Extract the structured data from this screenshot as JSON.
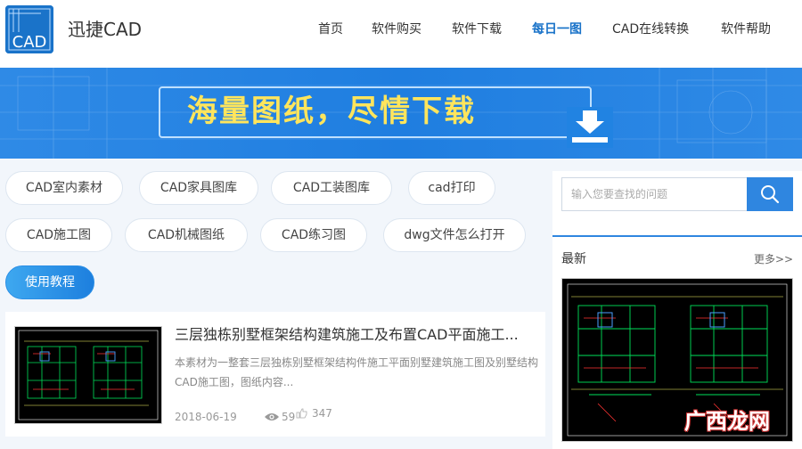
{
  "brand": {
    "logo_text": "CAD",
    "name": "迅捷CAD"
  },
  "nav": {
    "items": [
      {
        "label": "首页",
        "active": false
      },
      {
        "label": "软件购买",
        "active": false
      },
      {
        "label": "软件下载",
        "active": false
      },
      {
        "label": "每日一图",
        "active": true
      },
      {
        "label": "CAD在线转换",
        "active": false
      },
      {
        "label": "软件帮助",
        "active": false
      }
    ]
  },
  "banner": {
    "text": "海量图纸，尽情下载",
    "icon": "download-icon"
  },
  "tags": [
    "CAD室内素材",
    "CAD家具图库",
    "CAD工装图库",
    "cad打印",
    "CAD施工图",
    "CAD机械图纸",
    "CAD练习图",
    "dwg文件怎么打开",
    "使用教程"
  ],
  "article": {
    "title": "三层独栋别墅框架结构建筑施工及布置CAD平面施工...",
    "description": "本素材为一整套三层独栋别墅框架结构件施工平面别墅建筑施工图及别墅结构CAD施工图，图纸内容...",
    "date": "2018-06-19",
    "views": "59",
    "likes": "347"
  },
  "sidebar": {
    "search_placeholder": "输入您要查找的问题",
    "latest_label": "最新",
    "more_label": "更多>>"
  },
  "watermark": "广西龙网",
  "colors": {
    "accent": "#1a73c9",
    "banner_bg": "#2183e2",
    "banner_text": "#ffe55c",
    "cad_bg": "#000000"
  }
}
